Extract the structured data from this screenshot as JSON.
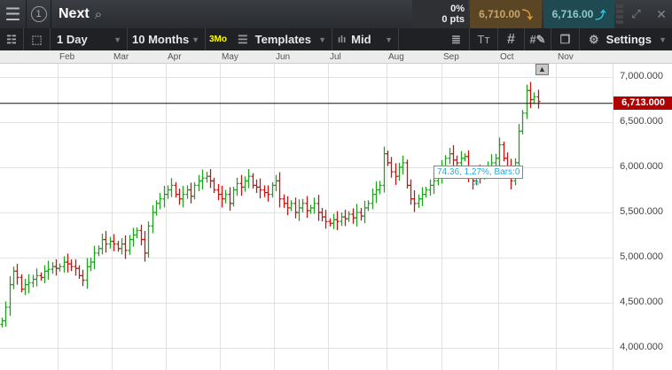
{
  "header": {
    "instrument": "Next",
    "change_pct": "0%",
    "change_pts": "0 pts",
    "sell": "6,710.00",
    "buy": "6,716.00",
    "badge": "1"
  },
  "toolbar": {
    "interval": "1 Day",
    "range": "10 Months",
    "preset": "3Mo",
    "templates": "Templates",
    "price_type": "Mid",
    "settings": "Settings"
  },
  "colors": {
    "up": "#22a022",
    "down": "#cc1111",
    "sell_bg": "#5a4524",
    "buy_bg": "#1f4a52",
    "price_tag": "#b00000",
    "tooltip": "#2aa6d6"
  },
  "chart_data": {
    "type": "ohlc",
    "x_ticks": [
      "Feb",
      "Mar",
      "Apr",
      "May",
      "Jun",
      "Jul",
      "Aug",
      "Sep",
      "Oct",
      "Nov"
    ],
    "y_ticks": [
      "7,000.000",
      "6,500.000",
      "6,000.000",
      "5,500.000",
      "5,000.000",
      "4,500.000",
      "4,000.000"
    ],
    "y_tick_values": [
      7000,
      6500,
      6000,
      5500,
      5000,
      4500,
      4000
    ],
    "ylim": [
      3875,
      7150
    ],
    "current_price": 6713,
    "current_price_label": "6,713.000",
    "measure_label": "74.36, 1.27%, Bars:0",
    "closes": [
      4300,
      4450,
      4700,
      4850,
      4780,
      4650,
      4700,
      4720,
      4760,
      4800,
      4780,
      4850,
      4870,
      4900,
      4880,
      4900,
      4950,
      4930,
      4900,
      4880,
      4800,
      4750,
      4900,
      4950,
      5050,
      5100,
      5200,
      5150,
      5180,
      5150,
      5100,
      5150,
      5080,
      5200,
      5250,
      5300,
      5200,
      5050,
      5350,
      5500,
      5600,
      5650,
      5700,
      5750,
      5800,
      5700,
      5650,
      5700,
      5750,
      5680,
      5800,
      5850,
      5880,
      5900,
      5850,
      5750,
      5700,
      5650,
      5700,
      5600,
      5750,
      5820,
      5780,
      5850,
      5900,
      5800,
      5780,
      5750,
      5720,
      5700,
      5800,
      5850,
      5650,
      5600,
      5550,
      5600,
      5500,
      5550,
      5600,
      5520,
      5550,
      5600,
      5500,
      5450,
      5400,
      5380,
      5420,
      5400,
      5450,
      5430,
      5480,
      5440,
      5500,
      5460,
      5550,
      5600,
      5700,
      5750,
      5800,
      6150,
      6050,
      5950,
      5900,
      6000,
      6050,
      5800,
      5650,
      5600,
      5650,
      5700,
      5750,
      5800,
      5850,
      5900,
      6000,
      6100,
      6150,
      6080,
      6050,
      6100,
      6120,
      5900,
      5850,
      5950,
      5900,
      5950,
      6000,
      6050,
      6100,
      6250,
      6100,
      6000,
      5850,
      6050,
      6400,
      6600,
      6850,
      6750,
      6780,
      6730
    ]
  }
}
